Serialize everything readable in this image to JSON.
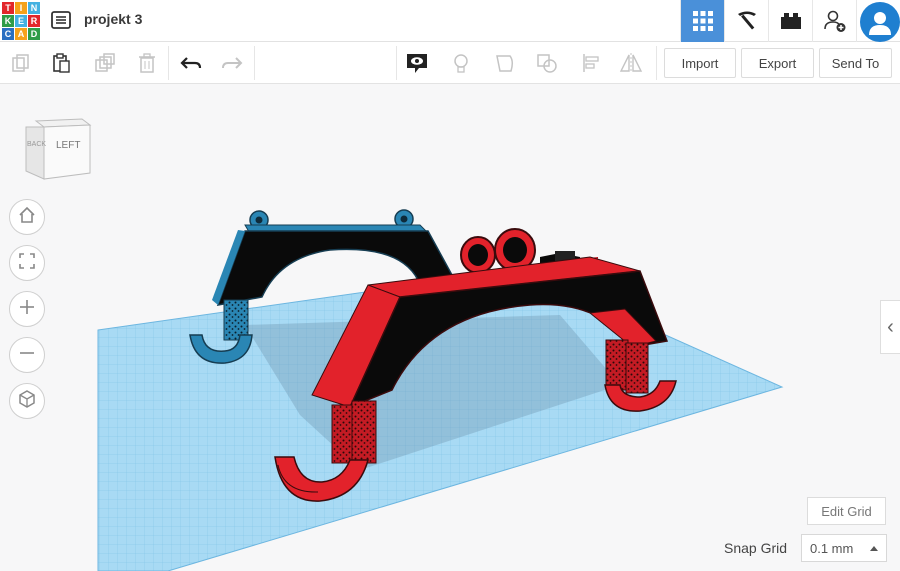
{
  "app": {
    "logo_letters": [
      "T",
      "I",
      "N",
      "K",
      "E",
      "R",
      "C",
      "A",
      "D"
    ],
    "project_title": "projekt 3"
  },
  "topnav": {
    "icons": [
      "grid-icon",
      "pickaxe-icon",
      "brick-icon",
      "add-user-icon",
      "avatar-icon"
    ]
  },
  "toolbar": {
    "import_label": "Import",
    "export_label": "Export",
    "send_to_label": "Send To"
  },
  "viewcube": {
    "front_label": "LEFT",
    "side_label": "BACK"
  },
  "grid": {
    "edit_grid_label": "Edit Grid",
    "snap_grid_label": "Snap Grid",
    "snap_value": "0.1 mm"
  },
  "colors": {
    "accent": "#4a90d9",
    "workplane": "#9fd3f0",
    "red_part": "#e2222b",
    "blue_part": "#2a86b4",
    "dark_face": "#000000"
  }
}
